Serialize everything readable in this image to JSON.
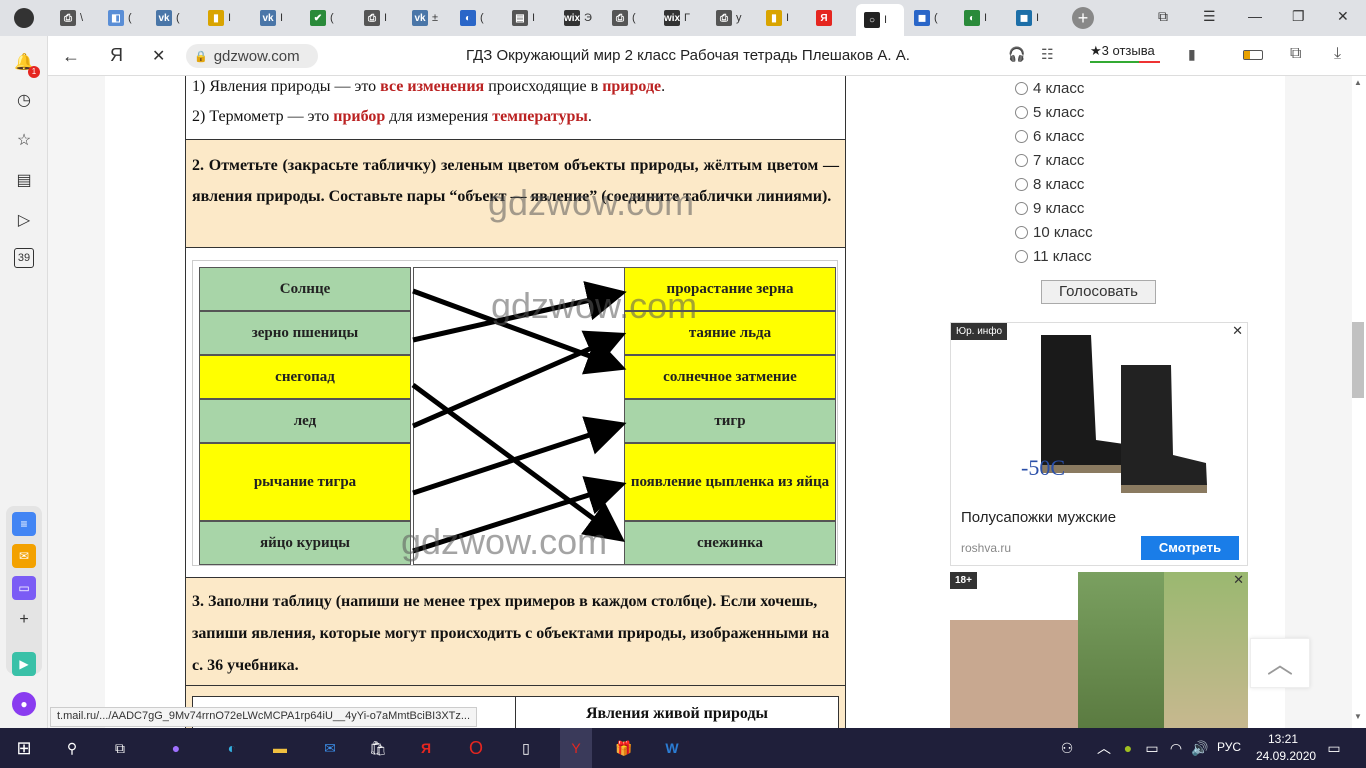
{
  "browser": {
    "tabs": [
      {
        "glyph": "⎙",
        "label": "\\",
        "color": "#555"
      },
      {
        "glyph": "◧",
        "label": "(",
        "color": "#5a8ed6"
      },
      {
        "glyph": "vk",
        "label": "(",
        "color": "#4a76a8"
      },
      {
        "glyph": "▮",
        "label": "I",
        "color": "#d9a400"
      },
      {
        "glyph": "vk",
        "label": "I",
        "color": "#4a76a8"
      },
      {
        "glyph": "✔",
        "label": "(",
        "color": "#2a8a3a"
      },
      {
        "glyph": "⎙",
        "label": "I",
        "color": "#555"
      },
      {
        "glyph": "vk",
        "label": "±",
        "color": "#4a76a8"
      },
      {
        "glyph": "◐",
        "label": "(",
        "color": "#2a66c8"
      },
      {
        "glyph": "▤",
        "label": "I",
        "color": "#555"
      },
      {
        "glyph": "wix",
        "label": "Э",
        "color": "#333"
      },
      {
        "glyph": "⎙",
        "label": "(",
        "color": "#555"
      },
      {
        "glyph": "wix",
        "label": "Γ",
        "color": "#333"
      },
      {
        "glyph": "⎙",
        "label": "y",
        "color": "#555"
      },
      {
        "glyph": "▮",
        "label": "I",
        "color": "#d9a400"
      },
      {
        "glyph": "Я",
        "label": "",
        "color": "#e52620"
      },
      {
        "glyph": "○",
        "label": "I",
        "color": "#222"
      },
      {
        "glyph": "◼",
        "label": "(",
        "color": "#2a66c8"
      },
      {
        "glyph": "◐",
        "label": "I",
        "color": "#2a8a3a"
      },
      {
        "glyph": "◼",
        "label": "I",
        "color": "#1d6fa8"
      }
    ],
    "new_tab": "+",
    "address": "gdzwow.com",
    "page_title": "ГДЗ Окружающий мир 2 класс Рабочая тетрадь Плешаков А. А.",
    "reviews": "★3 отзыва",
    "yandex_letter": "Я",
    "notif_count": "1",
    "sidebar_badge": "39",
    "status_url": "t.mail.ru/.../AADC7gG_9Mv74rrnO72eLWcMCPA1rp64iU__4yYi-o7aMmtBciBI3XTz..."
  },
  "task1": {
    "line1_prefix": "1) Явления природы — это ",
    "line1_bold1": "все изменения",
    "line1_mid": " происходящие в ",
    "line1_bold2": "природе",
    "line1_end": ".",
    "line2_prefix": "2) Термометр — это ",
    "line2_bold1": "прибор",
    "line2_mid": " для измерения ",
    "line2_bold2": "температуры",
    "line2_end": "."
  },
  "task2": {
    "text": "2. Отметьте (закрасьте табличку) зеленым цветом объекты природы, жёлтым цветом — явления природы. Составьте пары “объект — явление” (соедините таблички линиями).",
    "watermark": "gdzwow.com",
    "left": [
      {
        "label": "Солнце",
        "color": "green"
      },
      {
        "label": "зерно пшеницы",
        "color": "green"
      },
      {
        "label": "снегопад",
        "color": "yellow"
      },
      {
        "label": "лед",
        "color": "green"
      },
      {
        "label": "рычание тигра",
        "color": "yellow"
      },
      {
        "label": "яйцо курицы",
        "color": "green"
      }
    ],
    "right": [
      {
        "label": "прорастание зерна",
        "color": "yellow"
      },
      {
        "label": "таяние льда",
        "color": "yellow"
      },
      {
        "label": "солнечное затмение",
        "color": "yellow"
      },
      {
        "label": "тигр",
        "color": "green"
      },
      {
        "label": "появление цыпленка из яйца",
        "color": "yellow"
      },
      {
        "label": "снежинка",
        "color": "green"
      }
    ]
  },
  "task3": {
    "text": "3. Заполни таблицу (напиши не менее трех примеров в каждом столбце). Если хочешь, запиши явления, которые могут происходить с объектами природы, изображенными на с. 36 учебника.",
    "col2_header": "Явления живой природы"
  },
  "poll": {
    "options": [
      "4 класс",
      "5 класс",
      "6 класс",
      "7 класс",
      "8 класс",
      "9 класс",
      "10 класс",
      "11 класс"
    ],
    "vote_label": "Голосовать"
  },
  "ad1": {
    "tag": "Юр. инфо",
    "discount": "-50C",
    "title": "Полусапожки мужские",
    "domain": "roshva.ru",
    "cta": "Смотреть"
  },
  "ad2": {
    "tag": "18+"
  },
  "taskbar": {
    "lang": "РУС",
    "time": "13:21",
    "date": "24.09.2020"
  }
}
